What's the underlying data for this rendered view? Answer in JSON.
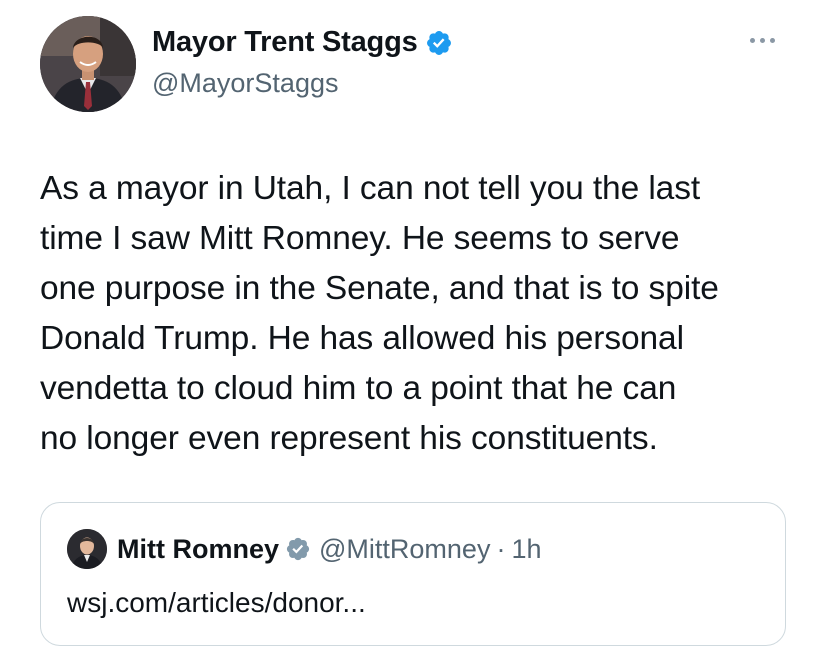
{
  "author": {
    "display_name": "Mayor Trent Staggs",
    "handle": "@MayorStaggs",
    "verified_icon": "verified-badge-icon",
    "avatar_icon": "avatar-photo"
  },
  "menu": {
    "icon": "more-options-icon"
  },
  "tweet": {
    "lines": [
      "As a mayor in Utah, I can not tell you the last",
      "time I saw Mitt Romney. He seems to serve",
      "one purpose in the Senate, and that is to spite",
      "Donald Trump. He has allowed his personal",
      "vendetta to cloud him to a point that he can",
      "no longer even represent his constituents."
    ]
  },
  "quoted": {
    "display_name": "Mitt Romney",
    "handle": "@MittRomney",
    "separator": "·",
    "time": "1h",
    "link_text": "wsj.com/articles/donor..."
  },
  "colors": {
    "verified_blue": "#1d9bf0",
    "quoted_verified_gray": "#829aab",
    "text_primary": "#0f1419",
    "text_secondary": "#536471",
    "border": "#cfd9de"
  }
}
